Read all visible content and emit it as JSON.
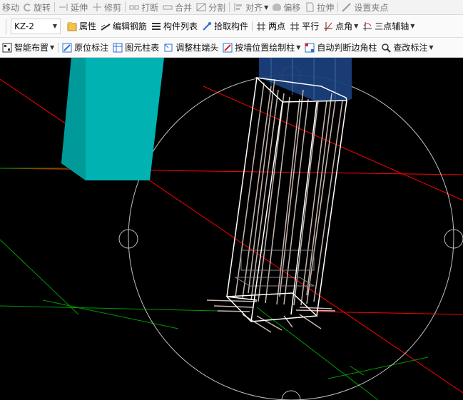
{
  "toolbar_edit": {
    "move": "移动",
    "rotate": "旋转",
    "extend": "延伸",
    "trim": "修剪",
    "break": "打断",
    "merge": "合并",
    "split": "分割",
    "align": "对齐",
    "offset": "偏移",
    "stretch": "拉伸",
    "set_grip": "设置夹点"
  },
  "toolbar_component": {
    "component_select": "KZ-2",
    "properties": "属性",
    "edit_rebar": "编辑钢筋",
    "component_list": "构件列表",
    "pick_component": "拾取构件",
    "two_points": "两点",
    "parallel": "平行",
    "point_angle": "点角",
    "three_point_axis": "三点辅轴"
  },
  "toolbar_draw": {
    "smart_layout": "智能布置",
    "in_situ_annotation": "原位标注",
    "drawing_column_table": "图元柱表",
    "adjust_column_end": "调整柱端头",
    "draw_by_wall_position": "按墙位置绘制柱",
    "auto_corner_column": "自动判断边角柱",
    "query_annotation": "查改标注"
  },
  "colors": {
    "canvas_bg": "#000000",
    "teal_column": "#00b2b2",
    "selected_column": "#1a3f7a",
    "red_axis": "#ff0000",
    "green_axis": "#009900",
    "rebar": "#c8b8b0",
    "wire": "#ffffff"
  }
}
